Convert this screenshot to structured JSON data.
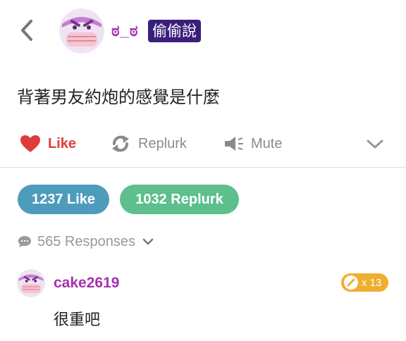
{
  "header": {
    "nickname": "ಠ_ಠ",
    "anonymous_badge": "偷偷說",
    "avatar_icon": "masked-face-avatar-icon"
  },
  "post": {
    "text": "背著男友約炮的感覺是什麼"
  },
  "actions": {
    "like_label": "Like",
    "replurk_label": "Replurk",
    "mute_label": "Mute",
    "more_icon": "chevron-down-icon"
  },
  "stats": {
    "likes_label": "1237 Like",
    "replurks_label": "1032 Replurk"
  },
  "responses": {
    "count_label": "565 Responses",
    "items": [
      {
        "username": "cake2619",
        "karma_label": "x 13",
        "text": "很重吧"
      }
    ]
  },
  "colors": {
    "like_red": "#e03b3b",
    "nick_purple": "#a830b0",
    "badge_navy": "#3a1f7a",
    "like_pill": "#4e9cbb",
    "replurk_pill": "#5dbf8e",
    "karma_orange": "#f0ae2e"
  }
}
